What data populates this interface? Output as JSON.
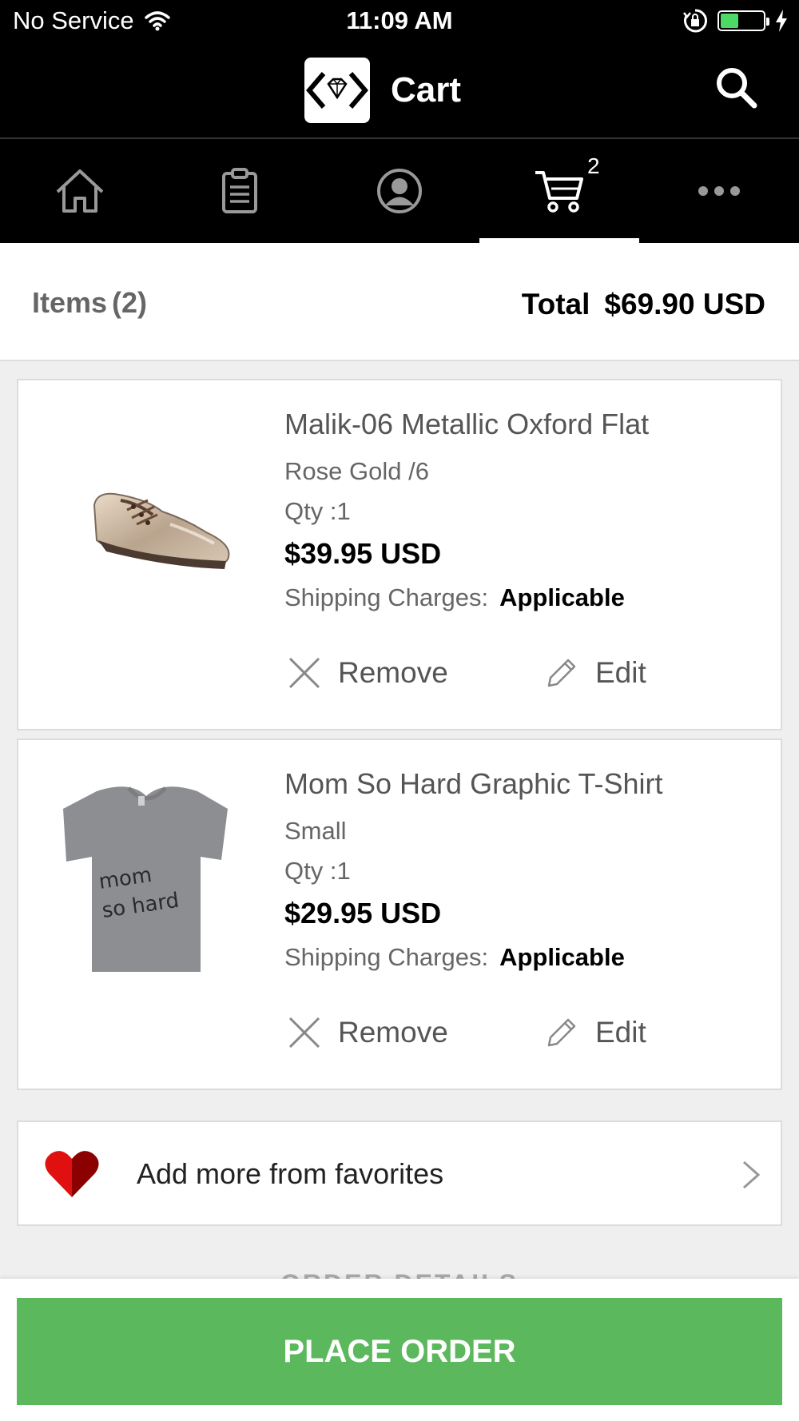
{
  "status_bar": {
    "carrier": "No Service",
    "time": "11:09 AM"
  },
  "header": {
    "title": "Cart"
  },
  "tabs": [
    {
      "name": "home",
      "icon": "home-icon"
    },
    {
      "name": "orders",
      "icon": "clipboard-icon"
    },
    {
      "name": "account",
      "icon": "user-icon"
    },
    {
      "name": "cart",
      "icon": "cart-icon",
      "badge": "2",
      "selected": true
    },
    {
      "name": "more",
      "icon": "more-icon"
    }
  ],
  "summary": {
    "items_label": "Items",
    "items_count": "(2)",
    "total_label": "Total",
    "total_value": "$69.90 USD"
  },
  "cart_items": [
    {
      "name": "Malik-06 Metallic Oxford Flat",
      "variant": "Rose Gold /6",
      "qty": "Qty :1",
      "price": "$39.95 USD",
      "shipping_label": "Shipping Charges:",
      "shipping_value": "Applicable",
      "remove_label": "Remove",
      "edit_label": "Edit"
    },
    {
      "name": "Mom So Hard Graphic T-Shirt",
      "variant": "Small",
      "qty": "Qty :1",
      "price": "$29.95 USD",
      "shipping_label": "Shipping Charges:",
      "shipping_value": "Applicable",
      "remove_label": "Remove",
      "edit_label": "Edit",
      "shirt_text_line1": "mom",
      "shirt_text_line2": "so hard"
    }
  ],
  "favorites": {
    "label": "Add more from favorites"
  },
  "section_peek": "ORDER DETAILS",
  "place_order_label": "PLACE ORDER",
  "colors": {
    "accent_green": "#5cb85c",
    "header_bg": "#000000",
    "heart_red": "#e01010"
  }
}
